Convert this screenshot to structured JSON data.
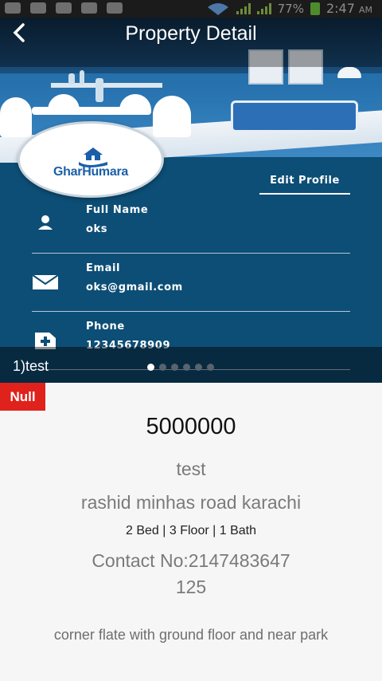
{
  "status_bar": {
    "battery": "77%",
    "time": "2:47",
    "ampm": "AM"
  },
  "header": {
    "title": "Property Detail",
    "back_icon": "chevron-left-icon"
  },
  "profile": {
    "logo_text_1": "Ghar",
    "logo_text_2": "Humara",
    "edit_label": "Edit Profile",
    "fields": [
      {
        "label": "Full Name",
        "value": "oks",
        "icon": "person-icon"
      },
      {
        "label": "Email",
        "value": "oks@gmail.com",
        "icon": "envelope-icon"
      },
      {
        "label": "Phone",
        "value": "12345678909",
        "icon": "phone-icon"
      }
    ]
  },
  "carousel": {
    "caption": "1)test",
    "page_count": 6,
    "active_index": 0
  },
  "badge": "Null",
  "property": {
    "price": "5000000",
    "title": "test",
    "address": "rashid minhas road karachi",
    "specs": "2 Bed | 3 Floor | 1 Bath",
    "contact": "Contact No:2147483647",
    "area": "125",
    "description": "corner flate with ground floor and near park"
  },
  "colors": {
    "banner_blue": "#0d4e76",
    "badge_red": "#e0221c",
    "logo_blue": "#1b5fa8"
  }
}
